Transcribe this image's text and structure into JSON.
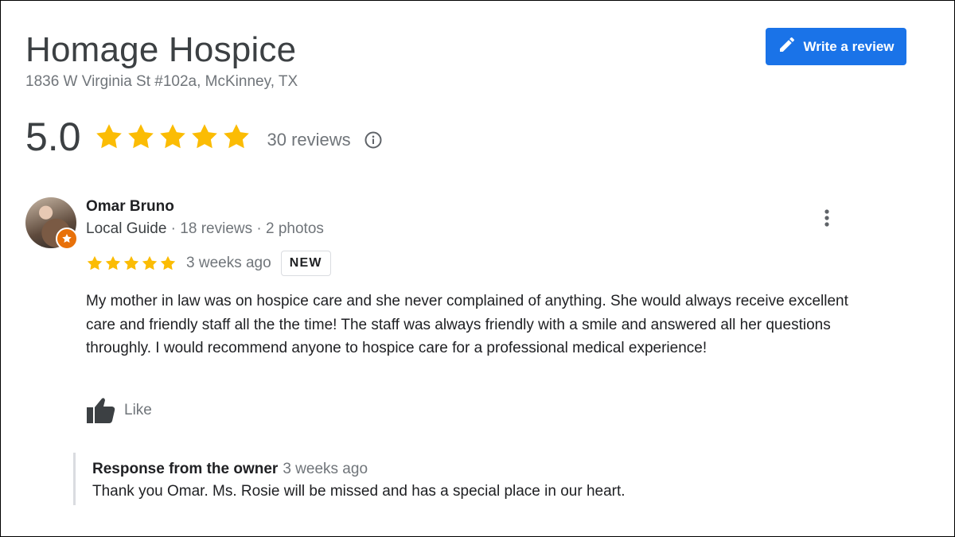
{
  "business": {
    "name": "Homage Hospice",
    "address": "1836 W Virginia St #102a, McKinney, TX",
    "rating": "5.0",
    "rating_stars": 5,
    "review_count": "30 reviews"
  },
  "actions": {
    "write_review_label": "Write a review",
    "write_review_icon": "pencil-icon"
  },
  "review": {
    "reviewer_name": "Omar Bruno",
    "reviewer_level": "Local Guide",
    "reviewer_stats": " · 18 reviews · 2 photos",
    "stars": 5,
    "time": "3 weeks ago",
    "badge": "NEW",
    "text": "My mother in law was on hospice care and she never complained of anything. She would always receive excellent care and friendly staff all the the time! The staff was always friendly with a smile and answered all her questions throughly. I would recommend anyone to hospice care for a professional medical experience!",
    "like_label": "Like"
  },
  "owner_response": {
    "label": "Response from the owner",
    "time": "3 weeks ago",
    "text": "Thank you Omar. Ms. Rosie will be missed and has a special place in our heart."
  },
  "colors": {
    "star": "#fbbc04",
    "primary_button": "#1a73e8",
    "local_guide_badge": "#e8710a"
  }
}
